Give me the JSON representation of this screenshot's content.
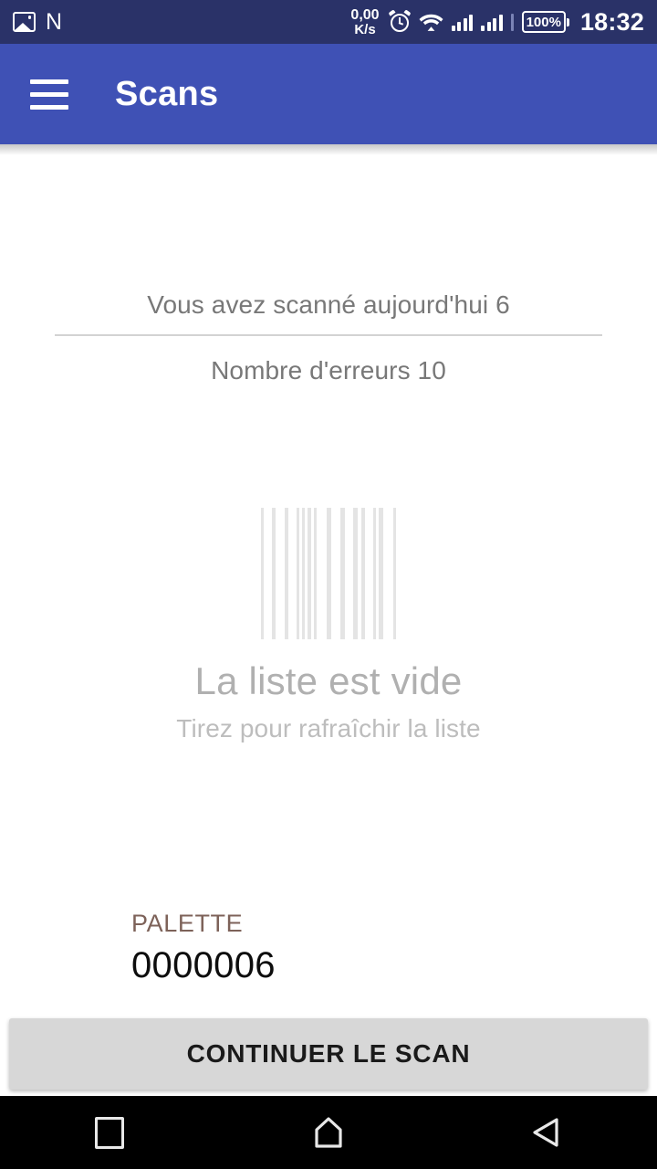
{
  "statusbar": {
    "icons": [
      "image-icon",
      "nfc-icon",
      "alarm-icon",
      "wifi-icon",
      "signal-icon",
      "battery-icon"
    ],
    "nfc_label": "N",
    "netspeed_value": "0,00",
    "netspeed_unit": "K/s",
    "battery_percent": "100%",
    "clock": "18:32",
    "background_color": "#2a3268"
  },
  "appbar": {
    "menu_icon": "hamburger-menu-icon",
    "title": "Scans",
    "background_color": "#3f51b5",
    "text_color": "#ffffff"
  },
  "stats": {
    "scanned_today": "Vous avez scanné aujourd'hui 6",
    "error_count": "Nombre d'erreurs 10",
    "text_color": "#787878"
  },
  "empty_state": {
    "icon": "barcode-icon",
    "title": "La liste est vide",
    "subtitle": "Tirez pour rafraîchir la liste",
    "title_color": "#b0b0b0",
    "bar_color": "#e4e4e4"
  },
  "palette": {
    "label": "PALETTE",
    "value": "0000006",
    "label_color": "#7d6259",
    "value_color": "#0d0d0d"
  },
  "cta": {
    "label": "CONTINUER LE SCAN",
    "background_color": "#d7d7d7",
    "text_color": "#1a1a1a"
  },
  "navbar": {
    "recents_label": "recents",
    "home_label": "home",
    "back_label": "back",
    "background_color": "#000000"
  },
  "barcode_bars": [
    {
      "w": 3,
      "gap": 9
    },
    {
      "w": 4,
      "gap": 10
    },
    {
      "w": 5,
      "gap": 9
    },
    {
      "w": 3,
      "gap": 3
    },
    {
      "w": 3,
      "gap": 3
    },
    {
      "w": 4,
      "gap": 3
    },
    {
      "w": 3,
      "gap": 11
    },
    {
      "w": 6,
      "gap": 10
    },
    {
      "w": 5,
      "gap": 9
    },
    {
      "w": 5,
      "gap": 4
    },
    {
      "w": 4,
      "gap": 9
    },
    {
      "w": 4,
      "gap": 3
    },
    {
      "w": 5,
      "gap": 11
    },
    {
      "w": 3,
      "gap": 0
    }
  ],
  "signal_bars_1": [
    6,
    10,
    14,
    18
  ],
  "signal_bars_2": [
    6,
    10,
    14,
    18
  ]
}
